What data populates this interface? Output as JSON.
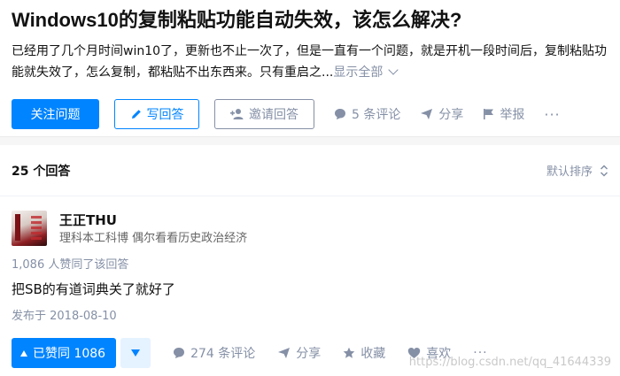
{
  "question": {
    "title": "Windows10的复制粘贴功能自动失效，该怎么解决?",
    "detail": "已经用了几个月时间win10了，更新也不止一次了，但是一直有一个问题，就是开机一段时间后，复制粘贴功能就失效了，怎么复制，都粘贴不出东西来。只有重启之...",
    "show_all": "显示全部",
    "actions": {
      "follow": "关注问题",
      "write_answer": "写回答",
      "invite": "邀请回答",
      "comments": "5 条评论",
      "share": "分享",
      "report": "举报",
      "more": "···"
    }
  },
  "answers_header": {
    "count": "25 个回答",
    "sort": "默认排序"
  },
  "answer": {
    "author": {
      "name": "王正THU",
      "bio": "理科本工科博 偶尔看看历史政治经济"
    },
    "vote_note": "1,086 人赞同了该回答",
    "content": "把SB的有道词典关了就好了",
    "published": "发布于 2018-08-10",
    "actions": {
      "upvote": "已赞同 1086",
      "comments": "274 条评论",
      "share": "分享",
      "collect": "收藏",
      "like": "喜欢",
      "more": "···"
    }
  },
  "watermark": "https://blog.csdn.net/qq_41644339",
  "colors": {
    "accent": "#0084ff",
    "meta_gray": "#8590a6"
  }
}
